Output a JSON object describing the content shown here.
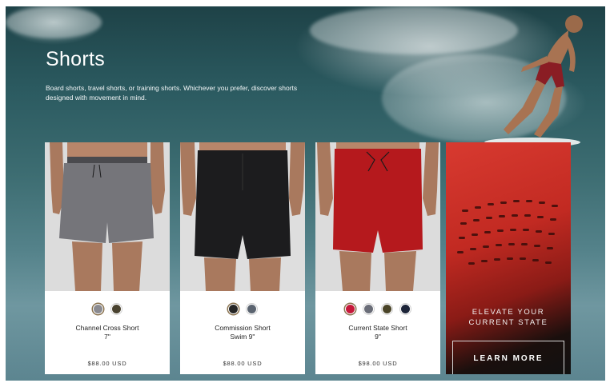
{
  "hero": {
    "title": "Shorts",
    "description": "Board shorts, travel shorts, or training shorts. Whichever you prefer, discover shorts designed with movement in mind."
  },
  "products": [
    {
      "name_line1": "Channel Cross Short",
      "name_line2": "7\"",
      "price": "$88.00 USD",
      "short_color": "#6e6e72",
      "swatches": [
        {
          "color": "#8a8a90",
          "selected": true
        },
        {
          "color": "#4a4330",
          "selected": false
        }
      ]
    },
    {
      "name_line1": "Commission Short",
      "name_line2": "Swim 9\"",
      "price": "$88.00 USD",
      "short_color": "#1c1c1e",
      "swatches": [
        {
          "color": "#262626",
          "selected": true
        },
        {
          "color": "#5b6470",
          "selected": false
        }
      ]
    },
    {
      "name_line1": "Current State Short",
      "name_line2": "9\"",
      "price": "$98.00 USD",
      "short_color": "#b5191d",
      "swatches": [
        {
          "color": "#c6183a",
          "selected": true
        },
        {
          "color": "#6a6d78",
          "selected": false
        },
        {
          "color": "#4a4428",
          "selected": false
        },
        {
          "color": "#1c2438",
          "selected": false
        }
      ]
    }
  ],
  "promo": {
    "line1": "ELEVATE YOUR",
    "line2": "CURRENT STATE",
    "button_label": "LEARN MORE"
  }
}
